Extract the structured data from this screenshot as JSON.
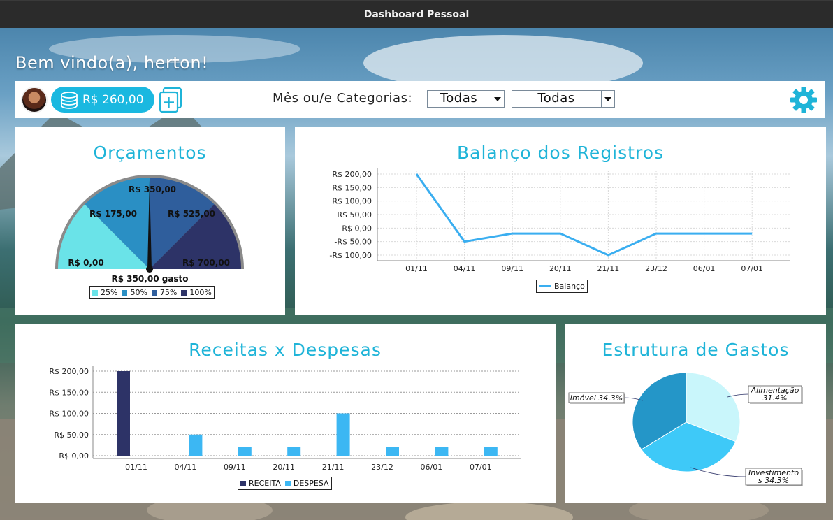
{
  "window": {
    "title": "Dashboard Pessoal"
  },
  "header": {
    "welcome": "Bem vindo(a), herton!"
  },
  "toolbar": {
    "balance": "R$ 260,00",
    "filter_label": "Mês ou/e Categorias:",
    "month_select": "Todas",
    "category_select": "Todas"
  },
  "colors": {
    "accent": "#1fb4d8",
    "receita": "#2d3367",
    "despesa": "#3cb7f3",
    "line": "#3aaef0"
  },
  "orcamentos": {
    "title": "Orçamentos",
    "spent_label": "R$ 350,00 gasto",
    "chart_data": {
      "type": "gauge",
      "value": 350,
      "range": [
        0,
        700
      ],
      "tick_labels": [
        "R$ 0,00",
        "R$ 175,00",
        "R$ 350,00",
        "R$ 525,00",
        "R$ 700,00"
      ],
      "bands": [
        {
          "name": "25%",
          "color": "#6ae3e8"
        },
        {
          "name": "50%",
          "color": "#2a8fc4"
        },
        {
          "name": "75%",
          "color": "#2f5e9c"
        },
        {
          "name": "100%",
          "color": "#2d3367"
        }
      ]
    }
  },
  "balanco": {
    "title": "Balanço dos Registros",
    "chart_data": {
      "type": "line",
      "categories": [
        "01/11",
        "04/11",
        "09/11",
        "20/11",
        "21/11",
        "23/12",
        "06/01",
        "07/01"
      ],
      "series": [
        {
          "name": "Balanço",
          "values": [
            200,
            -50,
            -20,
            -20,
            -100,
            -20,
            -20,
            -20
          ]
        }
      ],
      "y_ticks": [
        "R$ 200,00",
        "R$ 150,00",
        "R$ 100,00",
        "R$ 50,00",
        "R$ 0,00",
        "-R$ 50,00",
        "-R$ 100,00"
      ],
      "ylim": [
        -100,
        200
      ],
      "grid": true,
      "legend": "bottom"
    }
  },
  "receitas_despesas": {
    "title": "Receitas x Despesas",
    "chart_data": {
      "type": "bar",
      "categories": [
        "01/11",
        "04/11",
        "09/11",
        "20/11",
        "21/11",
        "23/12",
        "06/01",
        "07/01"
      ],
      "series": [
        {
          "name": "RECEITA",
          "values": [
            200,
            0,
            0,
            0,
            0,
            0,
            0,
            0
          ]
        },
        {
          "name": "DESPESA",
          "values": [
            0,
            50,
            20,
            20,
            100,
            20,
            20,
            20
          ]
        }
      ],
      "y_ticks": [
        "R$ 200,00",
        "R$ 150,00",
        "R$ 100,00",
        "R$ 50,00",
        "R$ 0,00"
      ],
      "ylim": [
        0,
        200
      ],
      "grid": true,
      "legend": "bottom"
    }
  },
  "estrutura": {
    "title": "Estrutura de Gastos",
    "chart_data": {
      "type": "pie",
      "slices": [
        {
          "label_line1": "Alimentação",
          "label_line2": "31.4%",
          "value": 31.4,
          "color": "#c9f6fb"
        },
        {
          "label_line1": "Investimento",
          "label_line2": "s 34.3%",
          "value": 34.3,
          "color": "#3ec9f8"
        },
        {
          "label_line1": "Imóvel 34.3%",
          "label_line2": "",
          "value": 34.3,
          "color": "#2496c8"
        }
      ]
    }
  }
}
